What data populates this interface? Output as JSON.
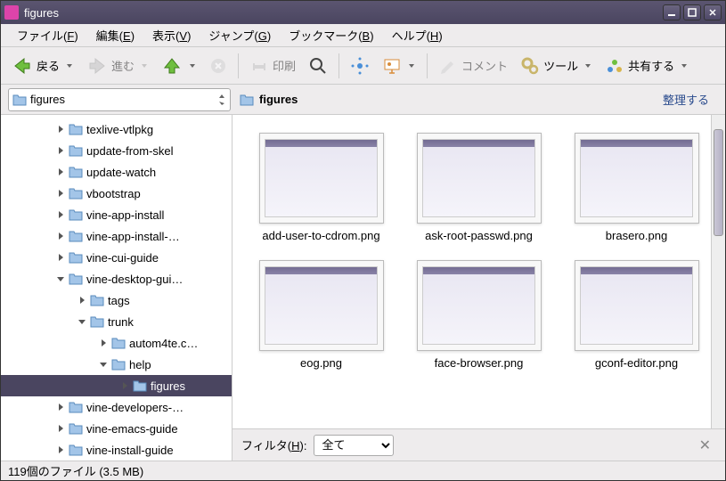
{
  "window": {
    "title": "figures"
  },
  "menubar": [
    {
      "label": "ファイル",
      "accel": "F"
    },
    {
      "label": "編集",
      "accel": "E"
    },
    {
      "label": "表示",
      "accel": "V"
    },
    {
      "label": "ジャンプ",
      "accel": "G"
    },
    {
      "label": "ブックマーク",
      "accel": "B"
    },
    {
      "label": "ヘルプ",
      "accel": "H"
    }
  ],
  "toolbar": {
    "back": "戻る",
    "forward": "進む",
    "print": "印刷",
    "comment": "コメント",
    "tool": "ツール",
    "share": "共有する"
  },
  "locbar": {
    "path_field": "figures",
    "breadcrumb": "figures",
    "organize": "整理する"
  },
  "sidebar": [
    {
      "label": "texlive-vtlpkg",
      "expander": "right",
      "indent": 5
    },
    {
      "label": "update-from-skel",
      "expander": "right",
      "indent": 5
    },
    {
      "label": "update-watch",
      "expander": "right",
      "indent": 5
    },
    {
      "label": "vbootstrap",
      "expander": "right",
      "indent": 5
    },
    {
      "label": "vine-app-install",
      "expander": "right",
      "indent": 5
    },
    {
      "label": "vine-app-install-…",
      "expander": "right",
      "indent": 5
    },
    {
      "label": "vine-cui-guide",
      "expander": "right",
      "indent": 5
    },
    {
      "label": "vine-desktop-gui…",
      "expander": "down",
      "indent": 5
    },
    {
      "label": "tags",
      "expander": "right",
      "indent": 7
    },
    {
      "label": "trunk",
      "expander": "down",
      "indent": 7
    },
    {
      "label": "autom4te.c…",
      "expander": "right",
      "indent": 9
    },
    {
      "label": "help",
      "expander": "down",
      "indent": 9
    },
    {
      "label": "figures",
      "expander": "right",
      "indent": 11,
      "selected": true
    },
    {
      "label": "vine-developers-…",
      "expander": "right",
      "indent": 5
    },
    {
      "label": "vine-emacs-guide",
      "expander": "right",
      "indent": 5
    },
    {
      "label": "vine-install-guide",
      "expander": "right",
      "indent": 5
    }
  ],
  "files": [
    {
      "name": "add-user-to-cdrom.png"
    },
    {
      "name": "ask-root-passwd.png"
    },
    {
      "name": "brasero.png"
    },
    {
      "name": "eog.png"
    },
    {
      "name": "face-browser.png"
    },
    {
      "name": "gconf-editor.png"
    }
  ],
  "filter": {
    "label_pre": "フィルタ",
    "label_accel": "H",
    "selected": "全て"
  },
  "statusbar": "119個のファイル (3.5 MB)"
}
